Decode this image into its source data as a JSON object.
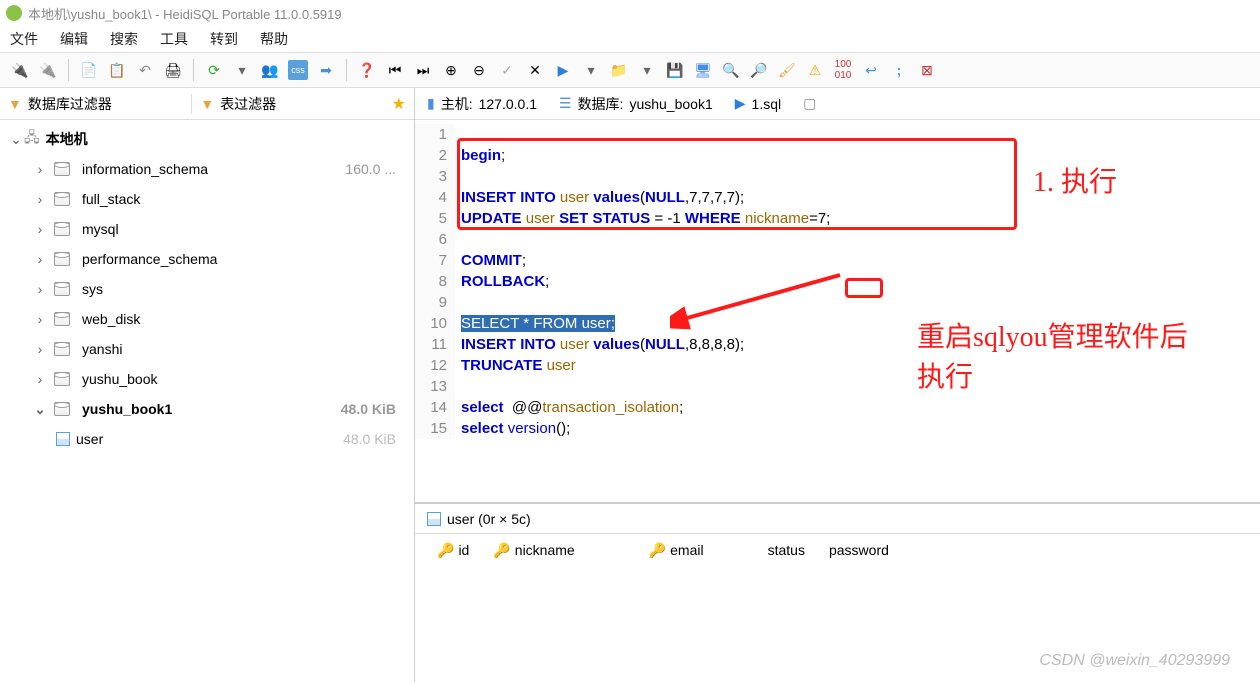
{
  "window": {
    "title": "本地机\\yushu_book1\\ - HeidiSQL Portable 11.0.0.5919"
  },
  "menu": {
    "file": "文件",
    "edit": "编辑",
    "search": "搜索",
    "tools": "工具",
    "goto": "转到",
    "help": "帮助"
  },
  "filters": {
    "db": "数据库过滤器",
    "table": "表过滤器"
  },
  "tree": {
    "root": "本地机",
    "items": [
      {
        "name": "information_schema",
        "size": "160.0 ..."
      },
      {
        "name": "full_stack",
        "size": ""
      },
      {
        "name": "mysql",
        "size": ""
      },
      {
        "name": "performance_schema",
        "size": ""
      },
      {
        "name": "sys",
        "size": ""
      },
      {
        "name": "web_disk",
        "size": ""
      },
      {
        "name": "yanshi",
        "size": ""
      },
      {
        "name": "yushu_book",
        "size": ""
      },
      {
        "name": "yushu_book1",
        "size": "48.0 KiB",
        "sel": true
      },
      {
        "name": "user",
        "size": "48.0 KiB",
        "leaf": true
      }
    ]
  },
  "tabs": {
    "host_label": "主机:",
    "host_val": "127.0.0.1",
    "db_label": "数据库:",
    "db_val": "yushu_book1",
    "sql": "1.sql"
  },
  "code_lines": [
    {
      "n": 1,
      "html": ""
    },
    {
      "n": 2,
      "html": "<span class='kw'>begin</span>;"
    },
    {
      "n": 3,
      "html": ""
    },
    {
      "n": 4,
      "html": "<span class='kw'>INSERT</span> <span class='kw'>INTO</span> <span class='id'>user</span> <span class='kw'>values</span>(<span class='kw'>NULL</span>,7,7,7,7);"
    },
    {
      "n": 5,
      "html": "<span class='kw'>UPDATE</span> <span class='id'>user</span> <span class='kw'>SET</span> <span class='kw'>STATUS</span> = -1 <span class='kw'>WHERE</span> <span class='id'>nickname</span>=7;"
    },
    {
      "n": 6,
      "html": ""
    },
    {
      "n": 7,
      "html": "<span class='kw'>COMMIT</span>;"
    },
    {
      "n": 8,
      "html": "<span class='kw'>ROLLBACK</span>;"
    },
    {
      "n": 9,
      "html": ""
    },
    {
      "n": 10,
      "html": "<span class='sel-hl'><span style='color:#fff'>SELECT * FROM user;</span></span>"
    },
    {
      "n": 11,
      "html": "<span class='kw'>INSERT</span> <span class='kw'>INTO</span> <span class='id'>user</span> <span class='kw'>values</span>(<span class='kw'>NULL</span>,8,8,8,8);"
    },
    {
      "n": 12,
      "html": "<span class='kw'>TRUNCATE</span> <span class='id'>user</span>"
    },
    {
      "n": 13,
      "html": ""
    },
    {
      "n": 14,
      "html": "<span class='kw'>select</span>  @@<span class='id'>transaction_isolation</span>;"
    },
    {
      "n": 15,
      "html": "<span class='kw'>select</span> <span class='fn'>version</span>();"
    }
  ],
  "annot": {
    "exec": "1. 执行",
    "restart": "重启sqlyou管理软件后执行"
  },
  "results": {
    "tab": "user (0r × 5c)",
    "cols": [
      "id",
      "nickname",
      "email",
      "status",
      "password"
    ]
  },
  "watermark": "CSDN @weixin_40293999"
}
